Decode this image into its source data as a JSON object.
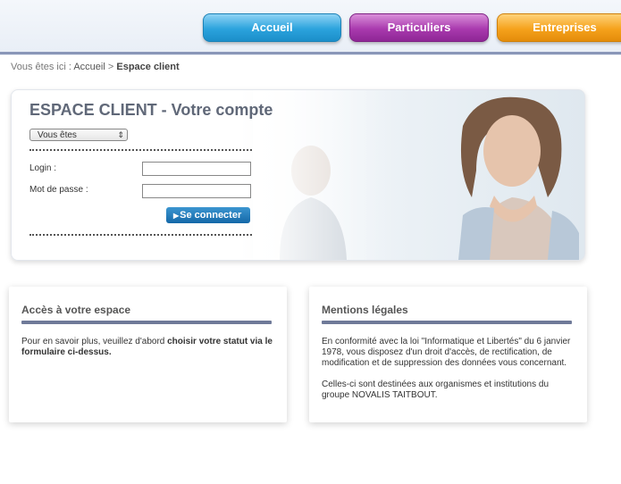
{
  "nav": {
    "tabs": [
      {
        "label": "Accueil",
        "color": "#2ba3dd"
      },
      {
        "label": "Particuliers",
        "color": "#a93aae"
      },
      {
        "label": "Entreprises",
        "color": "#f5a21c"
      }
    ]
  },
  "breadcrumb": {
    "prefix": "Vous êtes ici :",
    "home": "Accueil",
    "separator": ">",
    "current": "Espace client"
  },
  "login": {
    "title": "ESPACE CLIENT - Votre compte",
    "select_value": "Vous êtes",
    "login_label": "Login :",
    "password_label": "Mot de passe :",
    "login_value": "",
    "password_value": "",
    "submit_label": "Se connecter"
  },
  "access_panel": {
    "title": "Accès à votre espace",
    "text_intro": "Pour en savoir plus, veuillez d'abord ",
    "text_bold": "choisir votre statut via le formulaire ci-dessus."
  },
  "legal_panel": {
    "title": "Mentions légales",
    "paragraph1": "En conformité avec la loi \"Informatique et Libertés\" du 6 janvier 1978, vous disposez d'un droit d'accès, de rectification, de modification et de suppression des données vous concernant.",
    "paragraph2": "Celles-ci sont destinées aux organismes et institutions du groupe NOVALIS TAITBOUT."
  },
  "colors": {
    "rule": "#6f7a99",
    "button": "#1468a8"
  }
}
